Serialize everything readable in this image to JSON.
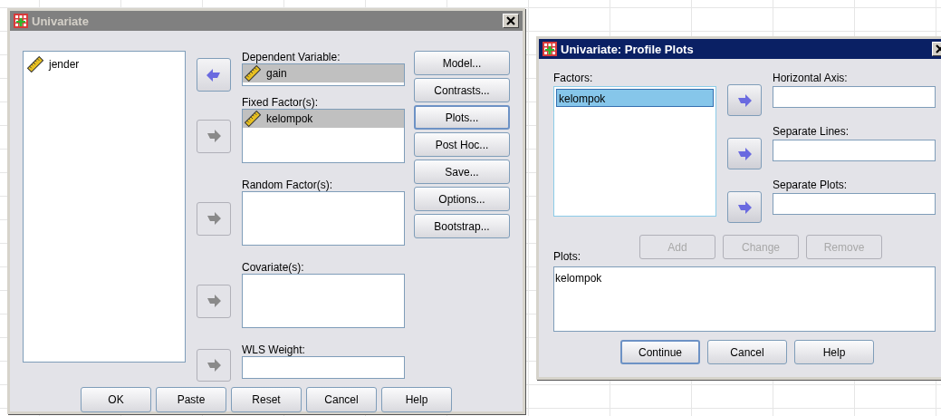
{
  "main_dialog": {
    "title": "Univariate",
    "active": false,
    "variables": [
      {
        "name": "jender",
        "selected": false
      }
    ],
    "targets": [
      {
        "label": "Dependent Variable:",
        "kind": "single",
        "arrow": {
          "kind": "left",
          "disabled": false
        },
        "items": [
          {
            "name": "gain",
            "selected": true
          }
        ]
      },
      {
        "label": "Fixed Factor(s):",
        "kind": "list",
        "arrow": {
          "kind": "right",
          "disabled": true
        },
        "items": [
          {
            "name": "kelompok",
            "selected": true
          }
        ]
      },
      {
        "label": "Random Factor(s):",
        "kind": "list",
        "arrow": {
          "kind": "right",
          "disabled": true
        }
      },
      {
        "label": "Covariate(s):",
        "kind": "list",
        "arrow": {
          "kind": "right",
          "disabled": true
        }
      },
      {
        "label": "WLS Weight:",
        "kind": "single",
        "arrow": {
          "kind": "right",
          "disabled": true
        }
      }
    ],
    "side_buttons": [
      {
        "label": "Model...",
        "focused": false
      },
      {
        "label": "Contrasts...",
        "focused": false
      },
      {
        "label": "Plots...",
        "focused": true
      },
      {
        "label": "Post Hoc...",
        "focused": false
      },
      {
        "label": "Save...",
        "focused": false
      },
      {
        "label": "Options...",
        "focused": false
      },
      {
        "label": "Bootstrap...",
        "focused": false
      }
    ],
    "buttons": [
      {
        "label": "OK",
        "focused": false
      },
      {
        "label": "Paste",
        "focused": false
      },
      {
        "label": "Reset",
        "focused": false
      },
      {
        "label": "Cancel",
        "focused": false
      },
      {
        "label": "Help",
        "focused": false
      }
    ]
  },
  "plots_dialog": {
    "title": "Univariate: Profile Plots",
    "active": true,
    "factors_label": "Factors:",
    "factors": [
      {
        "name": "kelompok",
        "selected": true
      }
    ],
    "targets": [
      {
        "label": "Horizontal Axis:",
        "arrow": {
          "kind": "right",
          "disabled": false
        }
      },
      {
        "label": "Separate Lines:",
        "arrow": {
          "kind": "right",
          "disabled": false
        }
      },
      {
        "label": "Separate Plots:",
        "arrow": {
          "kind": "right",
          "disabled": false
        }
      }
    ],
    "plots_label": "Plots:",
    "plot_actions": [
      {
        "label": "Add",
        "disabled": true
      },
      {
        "label": "Change",
        "disabled": true
      },
      {
        "label": "Remove",
        "disabled": true
      }
    ],
    "plots": [
      "kelompok"
    ],
    "buttons": [
      {
        "label": "Continue",
        "focused": true
      },
      {
        "label": "Cancel",
        "focused": false
      },
      {
        "label": "Help",
        "focused": false
      }
    ]
  }
}
